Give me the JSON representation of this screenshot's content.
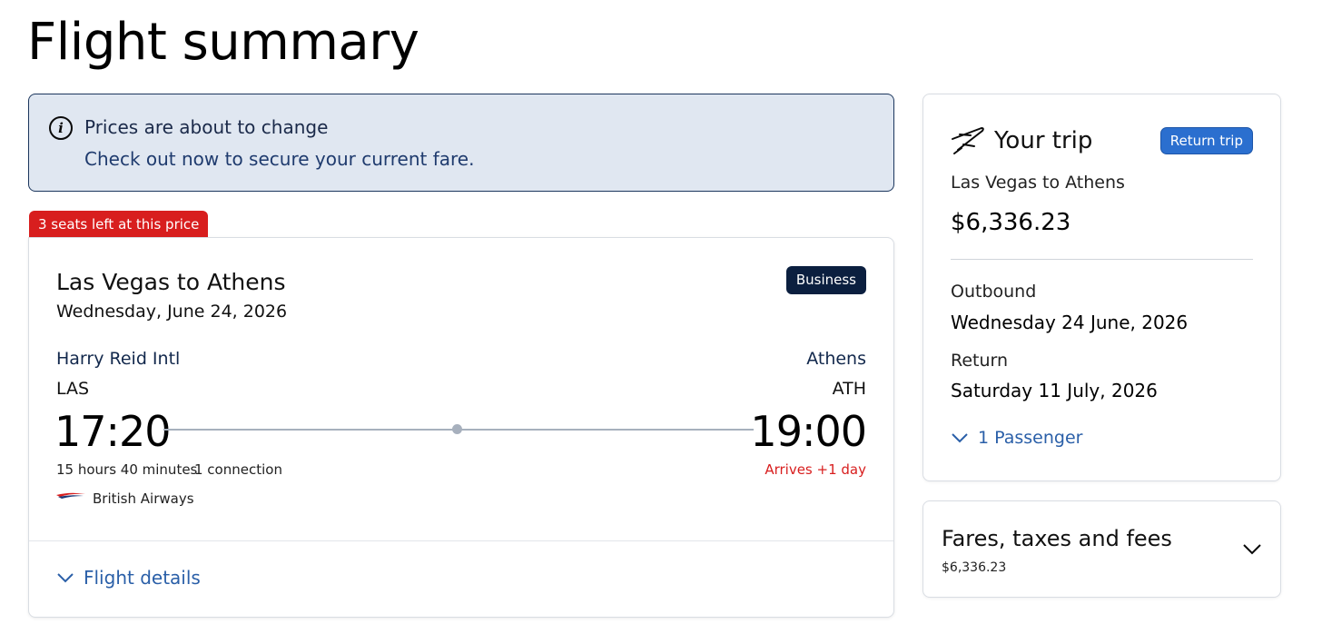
{
  "page": {
    "title": "Flight summary"
  },
  "notice": {
    "icon": "info-icon",
    "title": "Prices are about to change",
    "body": "Check out now to secure your current fare."
  },
  "seats_badge": "3 seats left at this price",
  "flight": {
    "route": "Las Vegas to Athens",
    "date": "Wednesday, June 24, 2026",
    "cabin": "Business",
    "origin": {
      "name": "Harry Reid Intl",
      "code": "LAS",
      "time": "17:20"
    },
    "destination": {
      "name": "Athens",
      "code": "ATH",
      "time": "19:00"
    },
    "duration": "15 hours 40 minutes",
    "connections": "1 connection",
    "arrives_note": "Arrives +1 day",
    "airline": "British Airways",
    "details_label": "Flight details"
  },
  "trip": {
    "icon": "airplane-icon",
    "title": "Your trip",
    "type": "Return trip",
    "route": "Las Vegas to Athens",
    "price": "$6,336.23",
    "outbound_label": "Outbound",
    "outbound_date": "Wednesday 24 June, 2026",
    "return_label": "Return",
    "return_date": "Saturday 11 July, 2026",
    "passengers": "1 Passenger"
  },
  "fares": {
    "title": "Fares, taxes and fees",
    "total": "$6,336.23"
  },
  "colors": {
    "brand_navy": "#0b1f3f",
    "link_blue": "#2a5fa8",
    "alert_red": "#d81e1e",
    "notice_bg": "#e0e7f1"
  }
}
